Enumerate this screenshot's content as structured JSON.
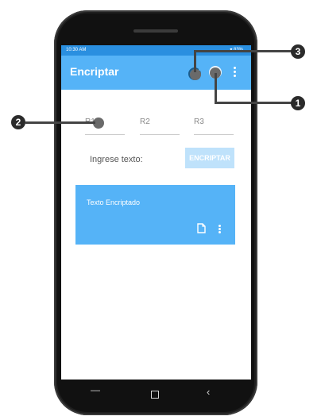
{
  "status_bar": {
    "time": "10:30 AM",
    "right": "▾ 83%"
  },
  "app_bar": {
    "title": "Encriptar",
    "icons": [
      "refresh-icon",
      "upload-icon",
      "more-vert-icon"
    ]
  },
  "fields": [
    {
      "placeholder": "R1",
      "value": ""
    },
    {
      "placeholder": "R2",
      "value": ""
    },
    {
      "placeholder": "R3",
      "value": ""
    }
  ],
  "prompt_label": "Ingrese texto:",
  "encrypt_button": "ENCRIPTAR",
  "result_card": {
    "label": "Texto Encriptado",
    "icons": [
      "copy-icon",
      "more-vert-icon"
    ]
  },
  "nav_bar": {
    "recent": "—",
    "back": "‹"
  },
  "annotations": [
    "1",
    "2",
    "3"
  ],
  "colors": {
    "primary": "#55b3f7",
    "primary_dark": "#2a8fe0",
    "button_disabled": "#bfe2fb",
    "annotation": "#2b2b2b"
  }
}
